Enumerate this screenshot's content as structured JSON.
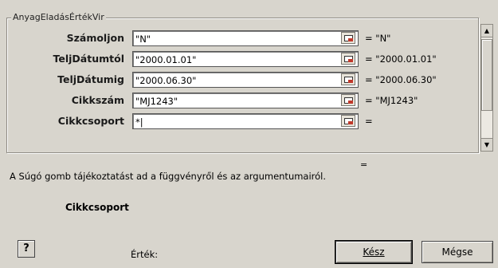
{
  "dialog": {
    "function_name": "AnyagEladásÉrtékVir",
    "arguments": [
      {
        "label": "Számoljon",
        "value": "\"N\"",
        "result": "= \"N\""
      },
      {
        "label": "TeljDátumtól",
        "value": "\"2000.01.01\"",
        "result": "= \"2000.01.01\""
      },
      {
        "label": "TeljDátumig",
        "value": "\"2000.06.30\"",
        "result": "= \"2000.06.30\""
      },
      {
        "label": "Cikkszám",
        "value": "\"MJ1243\"",
        "result": "= \"MJ1243\""
      },
      {
        "label": "Cikkcsoport",
        "value": "*|",
        "result": "="
      }
    ],
    "formula_result": "=",
    "help_text": "A Súgó gomb tájékoztatást ad a függvényről és az argumentumairól.",
    "current_argument": "Cikkcsoport",
    "help_button": "?",
    "value_label": "Érték:",
    "ok_button": "Kész",
    "cancel_button": "Mégse"
  }
}
